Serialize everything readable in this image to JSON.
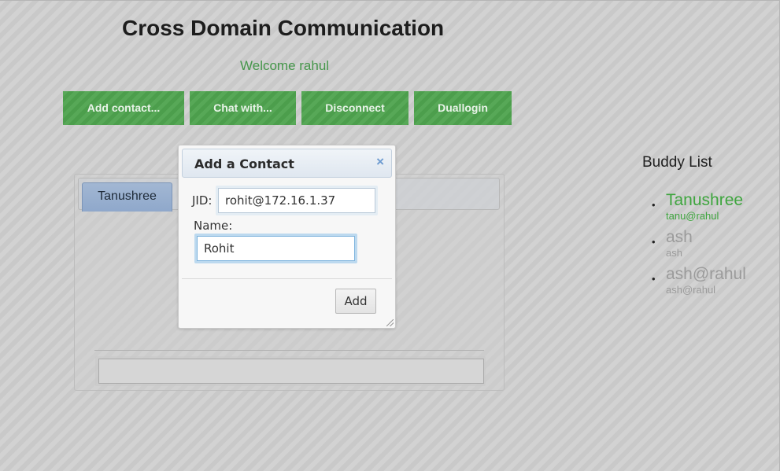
{
  "page": {
    "title": "Cross Domain Communication",
    "welcome": "Welcome rahul"
  },
  "actions": {
    "add_contact": "Add contact...",
    "chat_with": "Chat with...",
    "disconnect": "Disconnect",
    "duallogin": "Duallogin"
  },
  "chat": {
    "tabs": [
      {
        "label": "Tanushree"
      }
    ],
    "message_input": ""
  },
  "buddies": {
    "title": "Buddy List",
    "items": [
      {
        "name": "Tanushree",
        "jid": "tanu@rahul",
        "status": "online"
      },
      {
        "name": "ash",
        "jid": "ash",
        "status": "offline"
      },
      {
        "name": "ash@rahul",
        "jid": "ash@rahul",
        "status": "offline"
      }
    ]
  },
  "dialog": {
    "title": "Add a Contact",
    "close_symbol": "×",
    "jid_label": "JID:",
    "jid_value": "rohit@172.16.1.37",
    "name_label": "Name:",
    "name_value": "Rohit",
    "submit_label": "Add"
  },
  "colors": {
    "button_green": "#4ea34e",
    "online_green": "#3ea53e",
    "offline_gray": "#9b9b9b",
    "tab_blue": "#98aecf"
  }
}
